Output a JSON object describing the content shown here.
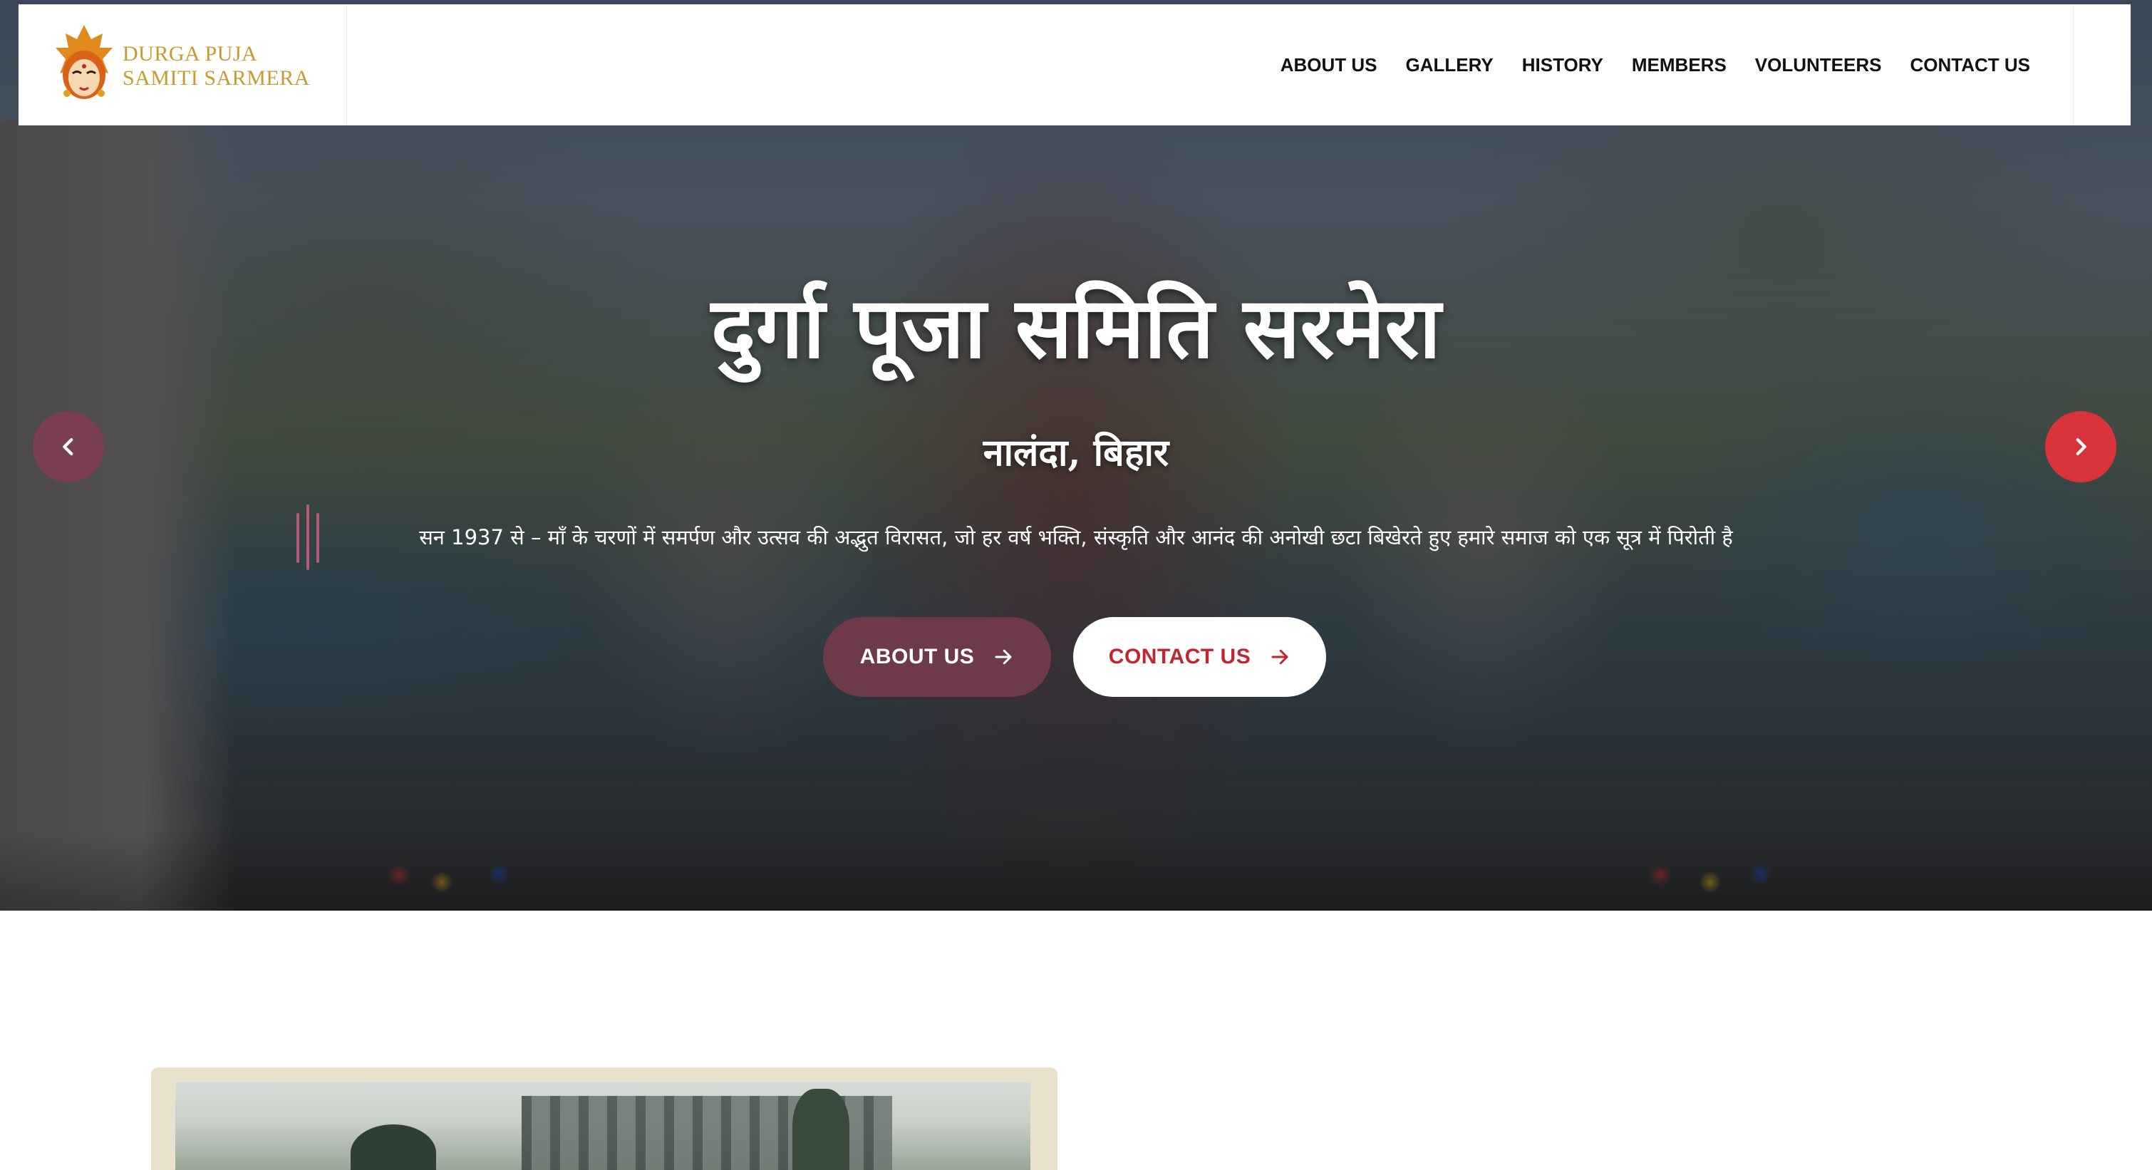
{
  "brand": {
    "line1": "DURGA PUJA",
    "line2": "SAMITI SARMERA",
    "logo_icon": "durga-face-icon",
    "color": "#c99a2e"
  },
  "nav": {
    "items": [
      {
        "label": "ABOUT US"
      },
      {
        "label": "GALLERY"
      },
      {
        "label": "HISTORY"
      },
      {
        "label": "MEMBERS"
      },
      {
        "label": "VOLUNTEERS"
      },
      {
        "label": "CONTACT US"
      }
    ]
  },
  "hero": {
    "title": "दुर्गा पूजा समिति सरमेरा",
    "subtitle": "नालंदा, बिहार",
    "tagline": "सन 1937 से – माँ के चरणों में समर्पण और उत्सव की अद्भुत विरासत, जो हर वर्ष भक्ति, संस्कृति और आनंद की अनोखी छटा बिखेरते हुए हमारे समाज को एक सूत्र में पिरोती है",
    "buttons": {
      "about": "ABOUT US",
      "contact": "CONTACT US"
    },
    "prev_icon": "chevron-left-icon",
    "next_icon": "chevron-right-icon"
  },
  "colors": {
    "about_button_bg": "#6e3a4a",
    "contact_button_text": "#c0262f",
    "prev_arrow_bg": "#7a3e55",
    "next_arrow_bg": "#d8333a"
  }
}
